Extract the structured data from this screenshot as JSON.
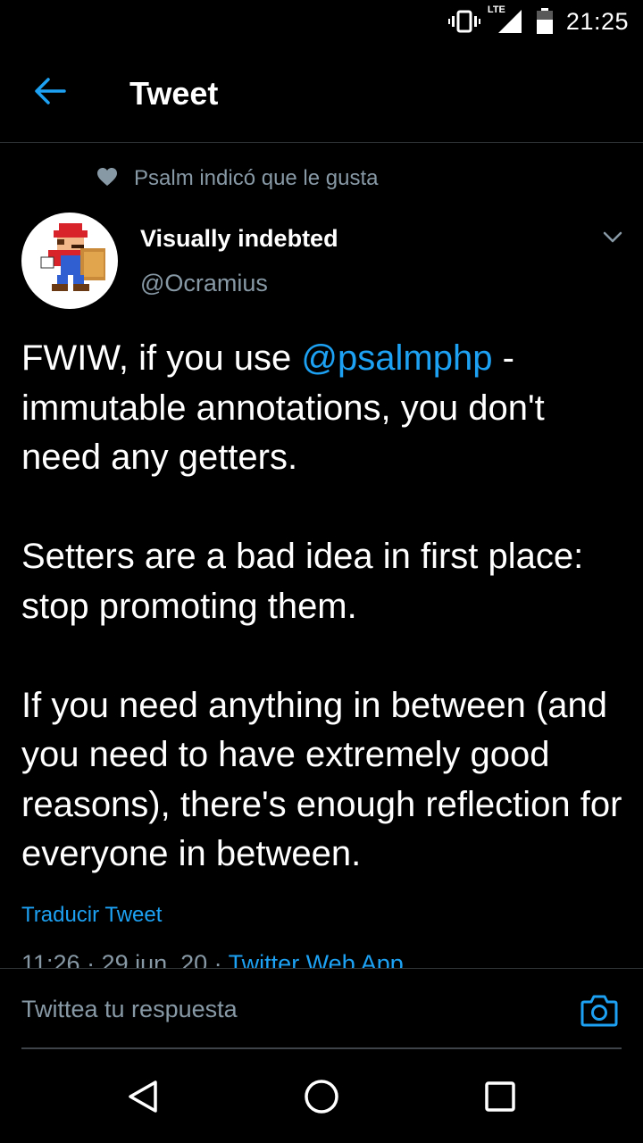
{
  "status_bar": {
    "time": "21:25",
    "network": "LTE",
    "icons": [
      "vibrate-icon",
      "signal-icon",
      "battery-icon"
    ]
  },
  "app_bar": {
    "back_icon": "arrow-left-icon",
    "title": "Tweet"
  },
  "context": {
    "icon": "heart-icon",
    "text": "Psalm indicó que le gusta"
  },
  "author": {
    "name": "Visually indebted",
    "handle": "@Ocramius",
    "avatar_icon": "pixel-mario-avatar"
  },
  "tweet": {
    "p1_pre": "FWIW, if you use ",
    "p1_mention": "@psalmphp",
    "p1_post": " - immutable annotations, you don't need any getters.",
    "p2": "Setters are a bad idea in first place: stop promoting them.",
    "p3": "If you need anything in between (and you need to have extremely good reasons), there's enough reflection for everyone in between.",
    "translate_label": "Traducir Tweet",
    "timestamp": "11:26 · 29 jun. 20 · ",
    "source_app": "Twitter Web App"
  },
  "reply": {
    "placeholder": "Twittea tu respuesta",
    "camera_icon": "camera-icon"
  },
  "navigation": {
    "buttons": [
      "back-triangle-icon",
      "home-circle-icon",
      "recents-square-icon"
    ]
  },
  "colors": {
    "background": "#000000",
    "accent": "#1da1f2",
    "secondary_text": "#8899a6",
    "divider": "#2f3336"
  }
}
